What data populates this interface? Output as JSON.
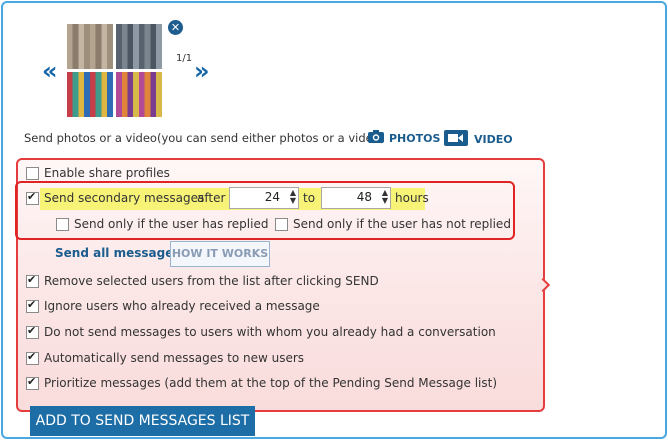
{
  "gallery": {
    "counter": "1/1",
    "thumbnails": [
      {
        "colors": [
          "#b3a58f",
          "#8b7c6b",
          "#c2b5a1",
          "#9d8f7b"
        ]
      },
      {
        "colors": [
          "#58626f",
          "#7a858f",
          "#4c5663",
          "#8f99a3"
        ]
      },
      {
        "colors": [
          "#c53e48",
          "#3f9b8c",
          "#e0b640",
          "#2e6cb5"
        ]
      },
      {
        "colors": [
          "#b24a95",
          "#e0843c",
          "#7a3c8f",
          "#d7b94a"
        ]
      }
    ]
  },
  "media": {
    "hint": "Send photos or a video(you can send either photos or a video)",
    "photos_label": "PHOTOS",
    "video_label": "VIDEO"
  },
  "options": {
    "enable_share_profiles": {
      "label": "Enable share profiles",
      "checked": false
    },
    "secondary": {
      "label_before": "Send secondary messages",
      "after_label": "after",
      "from_value": "24",
      "to_label": "to",
      "to_value": "48",
      "unit_label": "hours",
      "checked": true
    },
    "only_replied": {
      "label": "Send only if the user has replied",
      "checked": false
    },
    "only_not_replied": {
      "label": "Send only if the user has not replied",
      "checked": false
    },
    "send_all_label": "Send all messages",
    "how_it_works_label": "HOW IT WORKS",
    "checks": [
      {
        "label": "Remove selected users from the list after clicking SEND",
        "checked": true
      },
      {
        "label": "Ignore users who already received a message",
        "checked": true
      },
      {
        "label": "Do not send messages to users with whom you already had a conversation",
        "checked": true
      },
      {
        "label": "Automatically send messages to new users",
        "checked": true
      },
      {
        "label": "Prioritize messages (add them at the top of the Pending Send Message list)",
        "checked": true
      }
    ]
  },
  "add_button_label": "ADD TO SEND MESSAGES LIST"
}
